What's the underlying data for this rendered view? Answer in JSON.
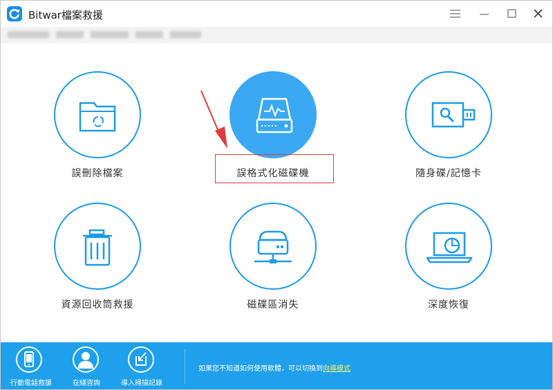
{
  "app": {
    "title": "Bitwar檔案救援"
  },
  "tiles": [
    {
      "label": "誤刪除檔案",
      "icon": "folder-recycle-icon"
    },
    {
      "label": "誤格式化磁碟機",
      "icon": "drive-pulse-icon",
      "selected": true
    },
    {
      "label": "隨身碟/記憶卡",
      "icon": "usb-drive-icon"
    },
    {
      "label": "資源回收筒救援",
      "icon": "trash-icon"
    },
    {
      "label": "磁碟區消失",
      "icon": "network-drive-icon"
    },
    {
      "label": "深度恢復",
      "icon": "laptop-scan-icon"
    }
  ],
  "footer": {
    "buttons": [
      {
        "label": "行動電話救援",
        "icon": "mobile-phone-icon"
      },
      {
        "label": "在綫咨詢",
        "icon": "user-support-icon"
      },
      {
        "label": "導入掃描記錄",
        "icon": "import-record-icon"
      }
    ],
    "hint_text": "如果您不知道如何使用軟體，可以切換到",
    "hint_link": "向導模式"
  },
  "colors": {
    "accent": "#1d9ae6",
    "footer": "#1ea0ec",
    "active_circle": "#3aa8f2",
    "highlight": "#e03c3c",
    "arrow": "#e03c3c",
    "link": "#f7f36b"
  }
}
